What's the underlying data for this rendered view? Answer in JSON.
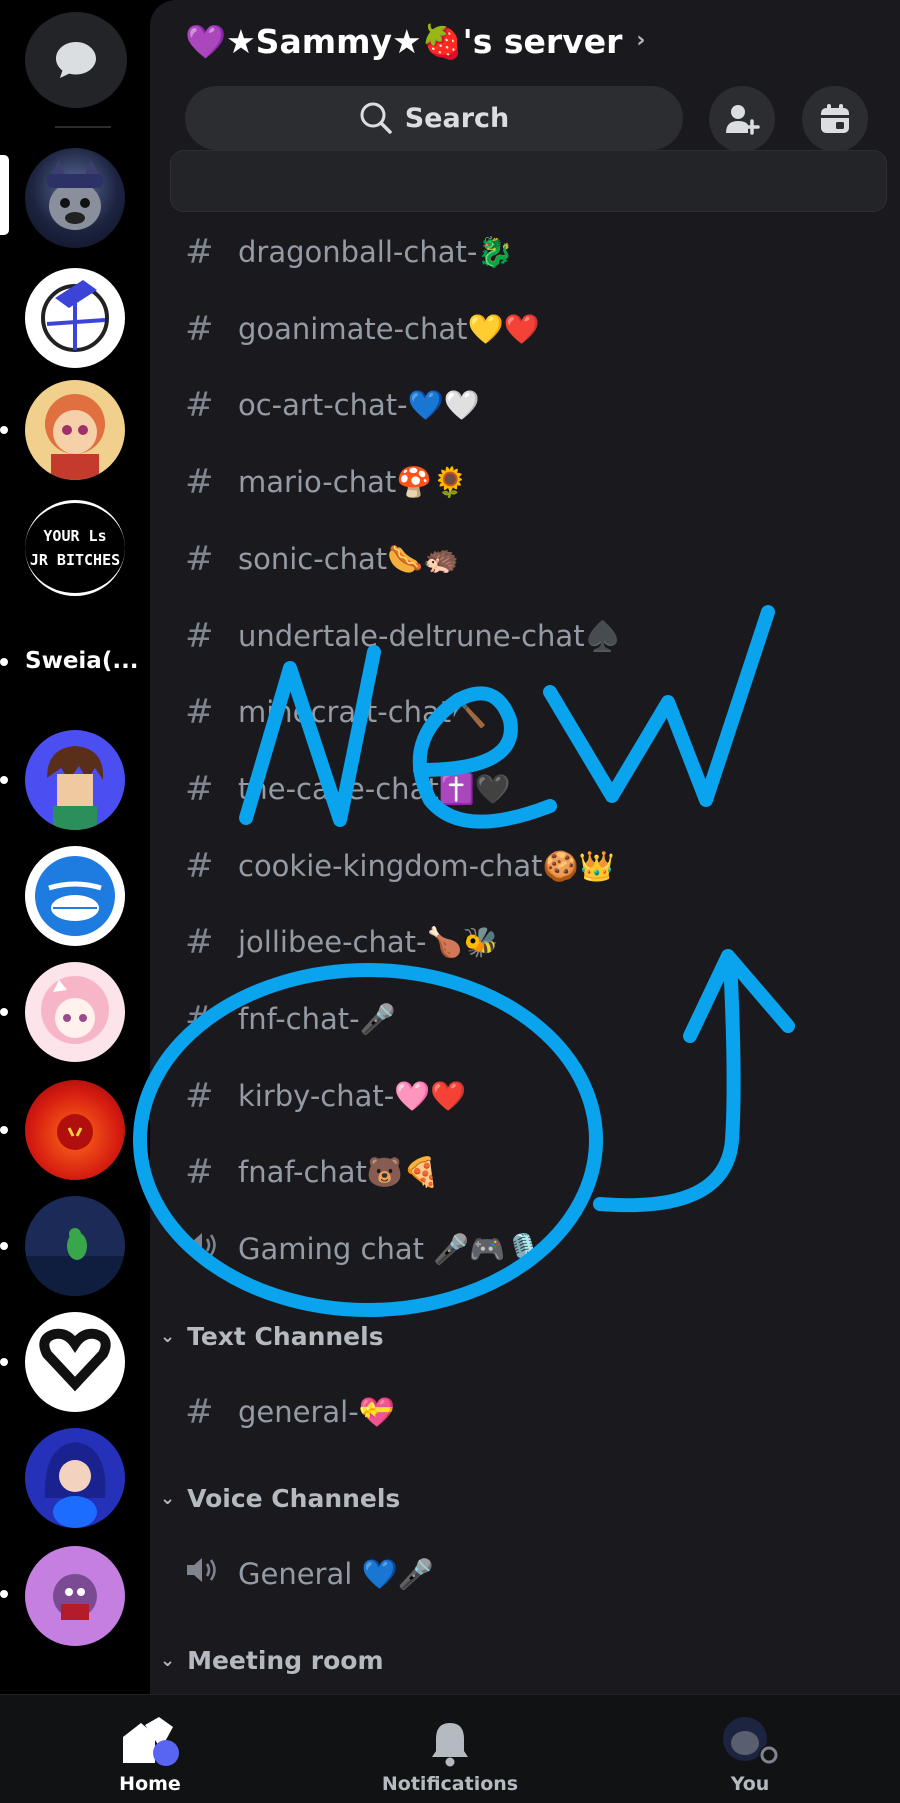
{
  "server": {
    "name": "💜★Sammy★🍓's server",
    "chevron": "›"
  },
  "search": {
    "label": "Search"
  },
  "rail": {
    "text_icon_lines": [
      "YOUR Ls",
      "JR BITCHES"
    ],
    "label": "Sweia(..."
  },
  "channels": [
    {
      "name": "dragonball-chat-🐉",
      "icon": "hash"
    },
    {
      "name": "goanimate-chat💛❤️",
      "icon": "hash"
    },
    {
      "name": "oc-art-chat-💙🤍",
      "icon": "hash"
    },
    {
      "name": "mario-chat🍄🌻",
      "icon": "hash"
    },
    {
      "name": "sonic-chat🌭🦔",
      "icon": "hash"
    },
    {
      "name": "undertale-deltrune-chat♠️",
      "icon": "hash"
    },
    {
      "name": "minecraft-chat⛏️",
      "icon": "hash"
    },
    {
      "name": "the-cave-chat✝️🖤",
      "icon": "hash"
    },
    {
      "name": "cookie-kingdom-chat🍪👑",
      "icon": "hash"
    },
    {
      "name": "jollibee-chat-🍗🐝",
      "icon": "hash"
    },
    {
      "name": "fnf-chat-🎤",
      "icon": "hash"
    },
    {
      "name": "kirby-chat-🩷❤️",
      "icon": "hash"
    },
    {
      "name": "fnaf-chat🐻🍕",
      "icon": "hash"
    },
    {
      "name": "Gaming chat 🎤🎮🎙️",
      "icon": "speaker"
    }
  ],
  "categories": {
    "text": {
      "label": "Text Channels",
      "channels": [
        {
          "name": "general-💝",
          "icon": "hash"
        }
      ]
    },
    "voice": {
      "label": "Voice Channels",
      "channels": [
        {
          "name": "General 💙🎤",
          "icon": "speaker"
        }
      ]
    },
    "meeting": {
      "label": "Meeting room"
    }
  },
  "annotation": {
    "text": "New",
    "color": "#0aa3ee",
    "shapes": [
      "circle",
      "arrow"
    ]
  },
  "tabs": [
    {
      "label": "Home",
      "active": true,
      "icon": "home-icon"
    },
    {
      "label": "Notifications",
      "active": false,
      "icon": "bell-icon"
    },
    {
      "label": "You",
      "active": false,
      "icon": "avatar"
    }
  ]
}
